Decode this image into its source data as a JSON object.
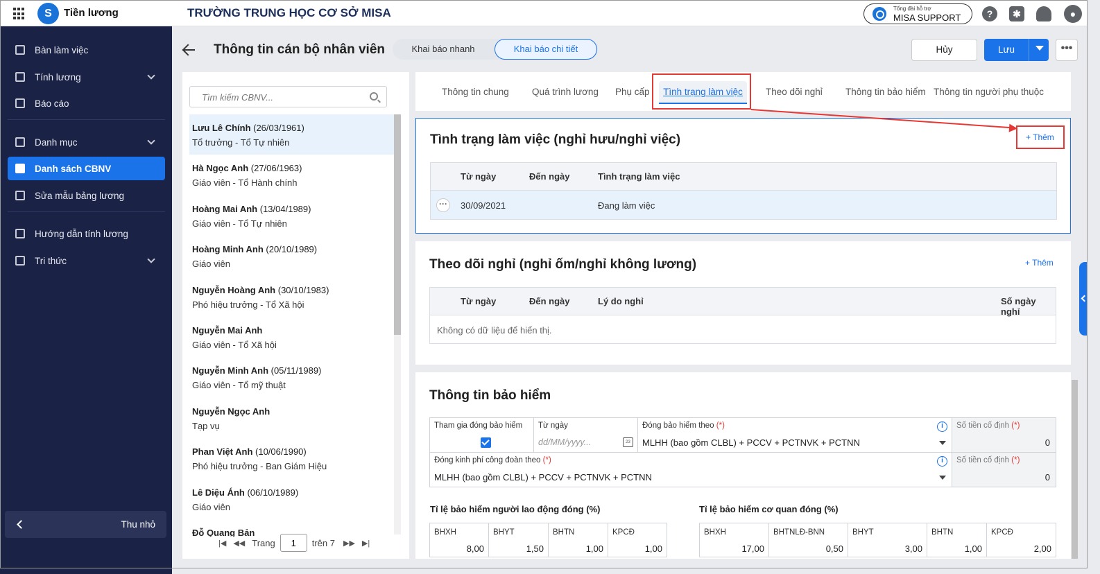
{
  "app": {
    "name": "Tiền lương",
    "school": "TRƯỜNG TRUNG HỌC CƠ SỞ MISA",
    "logo_icon": "misa-logo-icon"
  },
  "support": {
    "caption": "Tổng đài hỗ trợ",
    "label": "MISA SUPPORT"
  },
  "sidebar": {
    "items": [
      {
        "label": "Bàn làm việc",
        "icon": "desk-icon"
      },
      {
        "label": "Tính lương",
        "icon": "wallet-icon"
      },
      {
        "label": "Báo cáo",
        "icon": "chart-icon"
      },
      {
        "label": "Danh mục",
        "icon": "list-icon"
      },
      {
        "label": "Danh sách CBNV",
        "icon": "person-card-icon"
      },
      {
        "label": "Sửa mẫu bảng lương",
        "icon": "gear-doc-icon"
      },
      {
        "label": "Hướng dẫn tính lương",
        "icon": "guide-icon"
      },
      {
        "label": "Tri thức",
        "icon": "cube-icon"
      }
    ],
    "collapse_label": "Thu nhỏ"
  },
  "header": {
    "title": "Thông tin cán bộ nhân viên",
    "mode_quick": "Khai báo nhanh",
    "mode_detail": "Khai báo chi tiết",
    "cancel": "Hủy",
    "save": "Lưu",
    "more": "•••"
  },
  "employee_list": {
    "search_placeholder": "Tìm kiếm CBNV...",
    "items": [
      {
        "name": "Lưu Lê Chính",
        "dob": " (26/03/1961)",
        "role": "Tổ trưởng - Tổ Tự nhiên"
      },
      {
        "name": "Hà Ngọc Anh",
        "dob": " (27/06/1963)",
        "role": "Giáo viên - Tổ Hành chính"
      },
      {
        "name": "Hoàng Mai Anh",
        "dob": " (13/04/1989)",
        "role": "Giáo viên - Tổ Tự nhiên"
      },
      {
        "name": "Hoàng Minh Anh",
        "dob": " (20/10/1989)",
        "role": "Giáo viên"
      },
      {
        "name": "Nguyễn Hoàng Anh",
        "dob": " (30/10/1983)",
        "role": "Phó hiệu trưởng - Tổ Xã hội"
      },
      {
        "name": "Nguyễn Mai Anh",
        "dob": "",
        "role": "Giáo viên - Tổ Xã hội"
      },
      {
        "name": "Nguyễn Minh Anh",
        "dob": " (05/11/1989)",
        "role": "Giáo viên - Tổ mỹ thuật"
      },
      {
        "name": "Nguyễn Ngọc Anh",
        "dob": "",
        "role": "Tạp vụ"
      },
      {
        "name": "Phan Việt Anh",
        "dob": " (10/06/1990)",
        "role": "Phó hiệu trưởng - Ban Giám Hiệu"
      },
      {
        "name": "Lê Diệu Ánh",
        "dob": " (06/10/1989)",
        "role": "Giáo viên"
      },
      {
        "name": "Đỗ Quang Bản",
        "dob": "",
        "role": ""
      }
    ],
    "pager": {
      "page_label": "Trang",
      "page": "1",
      "total_label": "trên 7"
    }
  },
  "tabs": [
    "Thông tin chung",
    "Quá trình lương",
    "Phụ cấp",
    "Tình trạng làm việc",
    "Theo dõi nghỉ",
    "Thông tin bảo hiểm",
    "Thông tin người phụ thuộc"
  ],
  "work_status": {
    "title": "Tình trạng làm việc (nghỉ hưu/nghỉ việc)",
    "add": "+ Thêm",
    "columns": [
      "Từ ngày",
      "Đến ngày",
      "Tình trạng làm việc"
    ],
    "rows": [
      {
        "from": "30/09/2021",
        "to": "",
        "status": "Đang làm việc"
      }
    ]
  },
  "leave": {
    "title": "Theo dõi nghỉ (nghỉ ốm/nghỉ không lương)",
    "add": "+ Thêm",
    "columns": [
      "Từ ngày",
      "Đến ngày",
      "Lý do nghỉ",
      "Số ngày nghỉ"
    ],
    "empty": "Không có dữ liệu để hiển thị."
  },
  "insurance": {
    "title": "Thông tin bảo hiểm",
    "join_label": "Tham gia đóng bảo hiểm",
    "join_checked": true,
    "from_label": "Từ ngày",
    "from_placeholder": "dd/MM/yyyy...",
    "basis_label": "Đóng bảo hiểm theo",
    "basis_value": "MLHH (bao gồm CLBL) + PCCV + PCTNVK + PCTNN",
    "fixed_label": "Số tiền cố định",
    "fixed_value": "0",
    "union_label": "Đóng kinh phí công đoàn theo",
    "union_value": "MLHH (bao gồm CLBL) + PCCV + PCTNVK + PCTNN",
    "union_fixed_label": "Số tiền cố định",
    "union_fixed_value": "0",
    "required_mark": "(*)",
    "employee_rate_title": "Tỉ lệ bảo hiểm người lao động đóng (%)",
    "employee_rates": [
      {
        "label": "BHXH",
        "value": "8,00"
      },
      {
        "label": "BHYT",
        "value": "1,50"
      },
      {
        "label": "BHTN",
        "value": "1,00"
      },
      {
        "label": "KPCĐ",
        "value": "1,00"
      }
    ],
    "agency_rate_title": "Tỉ lệ bảo hiểm cơ quan đóng (%)",
    "agency_rates": [
      {
        "label": "BHXH",
        "value": "17,00"
      },
      {
        "label": "BHTNLĐ-BNN",
        "value": "0,50"
      },
      {
        "label": "BHYT",
        "value": "3,00"
      },
      {
        "label": "BHTN",
        "value": "1,00"
      },
      {
        "label": "KPCĐ",
        "value": "2,00"
      }
    ]
  },
  "colors": {
    "primary": "#1a73e8",
    "sidebar": "#1a2246",
    "highlight": "#e53935"
  }
}
